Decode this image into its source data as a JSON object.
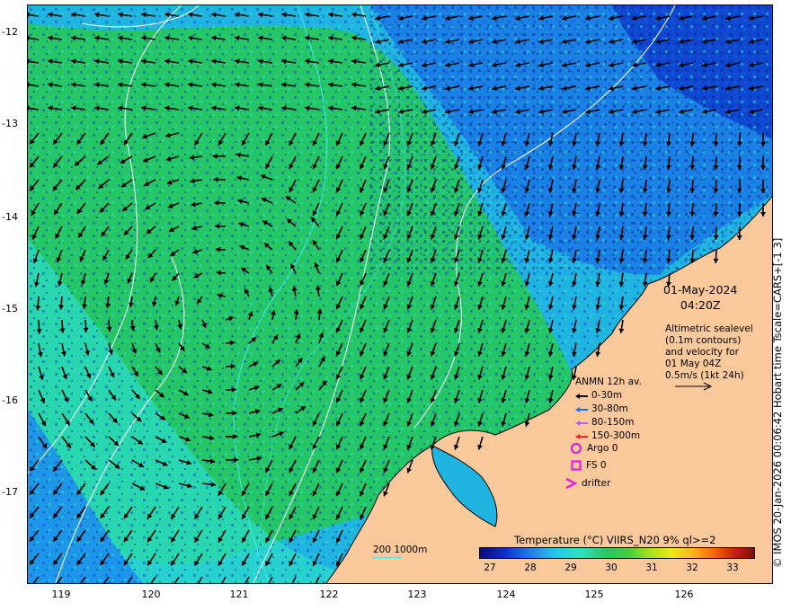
{
  "map": {
    "date": "01-May-2024",
    "time": "04:20Z",
    "altimetry_text": [
      "Altimetric sealevel",
      "(0.1m contours)",
      "and velocity for",
      "01 May 04Z",
      "0.5m/s (1kt 24h)"
    ],
    "credit": "© IMOS 20-Jan-2026 00:06:42 Hobart time Tscale=CARS+[-1 3]",
    "lon_ticks": [
      "119",
      "120",
      "121",
      "122",
      "123",
      "124",
      "125",
      "126"
    ],
    "lat_ticks": [
      "-12",
      "-13",
      "-14",
      "-15",
      "-16",
      "-17"
    ],
    "current_legend": {
      "title": "ANMN 12h av.",
      "items": [
        {
          "label": "0-30m",
          "color": "#000000"
        },
        {
          "label": "30-80m",
          "color": "#1f6fff"
        },
        {
          "label": "80-150m",
          "color": "#b060ff"
        },
        {
          "label": "150-300m",
          "color": "#ff2020"
        }
      ]
    },
    "argo": "Argo 0",
    "fs": "FS 0",
    "drifter": "drifter",
    "colorbar": {
      "title": "Temperature (°C) VIIRS_N20 9% ql>=2",
      "labels": [
        "27",
        "28",
        "29",
        "30",
        "31",
        "32",
        "33"
      ]
    },
    "bathymetry_legend": "200  1000m",
    "colors": {
      "land": "#f9c99b",
      "ocean_green": "#27c94f",
      "ocean_cyan": "#2bdcc8",
      "ocean_blue": "#1b8cf0",
      "contour_shallow": "#40e8e8",
      "contour_deep": "#ffffff",
      "marker": "#e020e0"
    }
  }
}
